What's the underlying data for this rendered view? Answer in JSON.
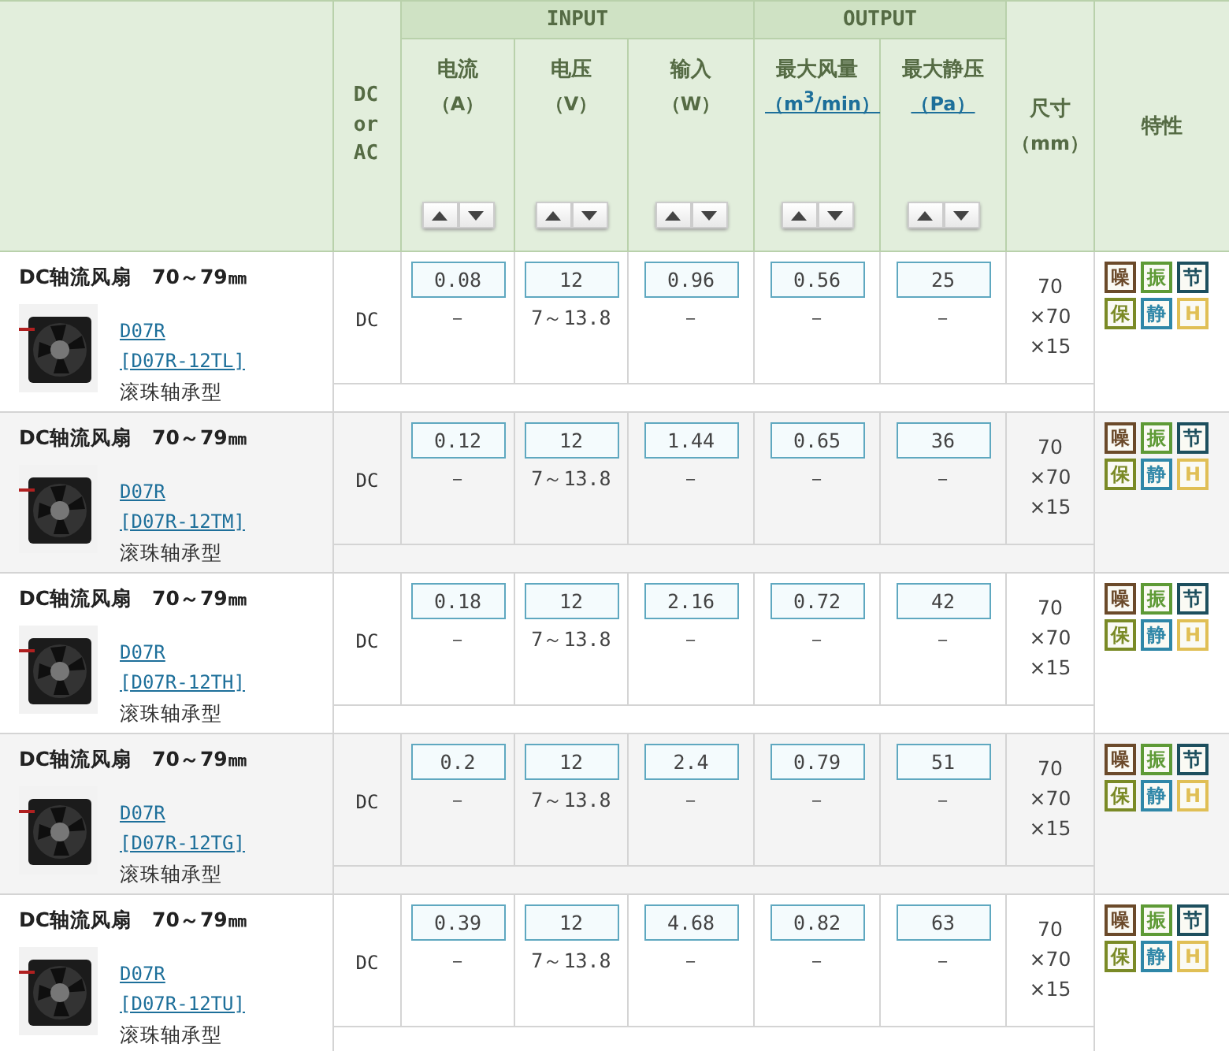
{
  "header": {
    "dc_ac": "DC or AC",
    "input": {
      "label": "INPUT",
      "columns": [
        {
          "label": "电流",
          "unit": "（A）",
          "unit_link": false
        },
        {
          "label": "电压",
          "unit": "（V）",
          "unit_link": false
        },
        {
          "label": "输入",
          "unit": "（W）",
          "unit_link": false
        }
      ]
    },
    "output": {
      "label": "OUTPUT",
      "columns": [
        {
          "label": "最大风量",
          "unit": "（m$^{3}$/min）",
          "unit_link": true
        },
        {
          "label": "最大静压",
          "unit": "（Pa）",
          "unit_link": true
        }
      ]
    },
    "size": {
      "label": "尺寸",
      "unit": "（mm）"
    },
    "features": "特性"
  },
  "rows": [
    {
      "title": "DC轴流风扇　70～79㎜",
      "model": "D07R",
      "code": "[D07R-12TL]",
      "bearing": "滚珠轴承型",
      "current": "DC",
      "values": [
        {
          "value": "0.08",
          "range": "－"
        },
        {
          "value": "12",
          "range": "7～13.8"
        },
        {
          "value": "0.96",
          "range": "－"
        },
        {
          "value": "0.56",
          "range": "－"
        },
        {
          "value": "25",
          "range": "－"
        }
      ],
      "size": "70 ×70 ×15",
      "features": [
        {
          "label": "噪",
          "color": "#6b4a2a"
        },
        {
          "label": "振",
          "color": "#5e9a36"
        },
        {
          "label": "节",
          "color": "#1d4f5e"
        },
        {
          "label": "保",
          "color": "#7a8a26"
        },
        {
          "label": "静",
          "color": "#2f87a8"
        },
        {
          "label": "H",
          "color": "#e0bf55"
        }
      ]
    },
    {
      "title": "DC轴流风扇　70～79㎜",
      "model": "D07R",
      "code": "[D07R-12TM]",
      "bearing": "滚珠轴承型",
      "current": "DC",
      "values": [
        {
          "value": "0.12",
          "range": "－"
        },
        {
          "value": "12",
          "range": "7～13.8"
        },
        {
          "value": "1.44",
          "range": "－"
        },
        {
          "value": "0.65",
          "range": "－"
        },
        {
          "value": "36",
          "range": "－"
        }
      ],
      "size": "70 ×70 ×15",
      "features": [
        {
          "label": "噪",
          "color": "#6b4a2a"
        },
        {
          "label": "振",
          "color": "#5e9a36"
        },
        {
          "label": "节",
          "color": "#1d4f5e"
        },
        {
          "label": "保",
          "color": "#7a8a26"
        },
        {
          "label": "静",
          "color": "#2f87a8"
        },
        {
          "label": "H",
          "color": "#e0bf55"
        }
      ]
    },
    {
      "title": "DC轴流风扇　70～79㎜",
      "model": "D07R",
      "code": "[D07R-12TH]",
      "bearing": "滚珠轴承型",
      "current": "DC",
      "values": [
        {
          "value": "0.18",
          "range": "－"
        },
        {
          "value": "12",
          "range": "7～13.8"
        },
        {
          "value": "2.16",
          "range": "－"
        },
        {
          "value": "0.72",
          "range": "－"
        },
        {
          "value": "42",
          "range": "－"
        }
      ],
      "size": "70 ×70 ×15",
      "features": [
        {
          "label": "噪",
          "color": "#6b4a2a"
        },
        {
          "label": "振",
          "color": "#5e9a36"
        },
        {
          "label": "节",
          "color": "#1d4f5e"
        },
        {
          "label": "保",
          "color": "#7a8a26"
        },
        {
          "label": "静",
          "color": "#2f87a8"
        },
        {
          "label": "H",
          "color": "#e0bf55"
        }
      ]
    },
    {
      "title": "DC轴流风扇　70～79㎜",
      "model": "D07R",
      "code": "[D07R-12TG]",
      "bearing": "滚珠轴承型",
      "current": "DC",
      "values": [
        {
          "value": "0.2",
          "range": "－"
        },
        {
          "value": "12",
          "range": "7～13.8"
        },
        {
          "value": "2.4",
          "range": "－"
        },
        {
          "value": "0.79",
          "range": "－"
        },
        {
          "value": "51",
          "range": "－"
        }
      ],
      "size": "70 ×70 ×15",
      "features": [
        {
          "label": "噪",
          "color": "#6b4a2a"
        },
        {
          "label": "振",
          "color": "#5e9a36"
        },
        {
          "label": "节",
          "color": "#1d4f5e"
        },
        {
          "label": "保",
          "color": "#7a8a26"
        },
        {
          "label": "静",
          "color": "#2f87a8"
        },
        {
          "label": "H",
          "color": "#e0bf55"
        }
      ]
    },
    {
      "title": "DC轴流风扇　70～79㎜",
      "model": "D07R",
      "code": "[D07R-12TU]",
      "bearing": "滚珠轴承型",
      "current": "DC",
      "values": [
        {
          "value": "0.39",
          "range": "－"
        },
        {
          "value": "12",
          "range": "7～13.8"
        },
        {
          "value": "4.68",
          "range": "－"
        },
        {
          "value": "0.82",
          "range": "－"
        },
        {
          "value": "63",
          "range": "－"
        }
      ],
      "size": "70 ×70 ×15",
      "features": [
        {
          "label": "噪",
          "color": "#6b4a2a"
        },
        {
          "label": "振",
          "color": "#5e9a36"
        },
        {
          "label": "节",
          "color": "#1d4f5e"
        },
        {
          "label": "保",
          "color": "#7a8a26"
        },
        {
          "label": "静",
          "color": "#2f87a8"
        },
        {
          "label": "H",
          "color": "#e0bf55"
        }
      ]
    }
  ]
}
